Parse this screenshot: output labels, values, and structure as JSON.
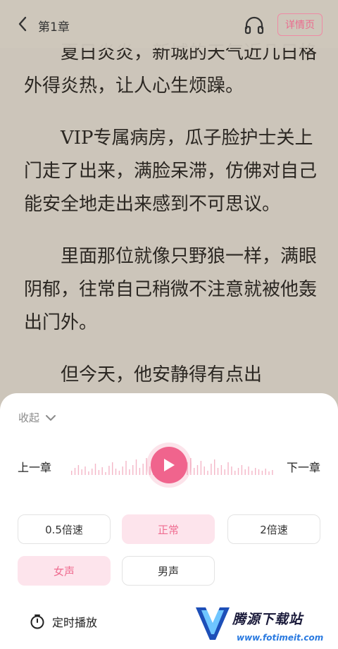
{
  "header": {
    "chapter_title": "第1章",
    "detail_button": "详情页"
  },
  "content": {
    "paragraphs": [
      "夏日炎炎，新城的天气近几日格外得炎热，让人心生烦躁。",
      "VIP专属病房，瓜子脸护士关上门走了出来，满脸呆滞，仿佛对自己能安全地走出来感到不可思议。",
      "里面那位就像只野狼一样，满眼阴郁，往常自己稍微不注意就被他轰出门外。",
      "但今天，他安静得有点出"
    ]
  },
  "player": {
    "collapse_label": "收起",
    "prev_chapter": "上一章",
    "next_chapter": "下一章",
    "speeds": [
      "0.5倍速",
      "正常",
      "2倍速"
    ],
    "selected_speed": "正常",
    "voices": [
      "女声",
      "男声"
    ],
    "selected_voice": "女声",
    "timer_label": "定时播放"
  },
  "watermark": {
    "title": "腾源下载站",
    "url": "www.fotimeit.com"
  },
  "colors": {
    "accent": "#f0648d",
    "accent_light": "#fde4ec",
    "page_bg": "#ddd6cb"
  }
}
